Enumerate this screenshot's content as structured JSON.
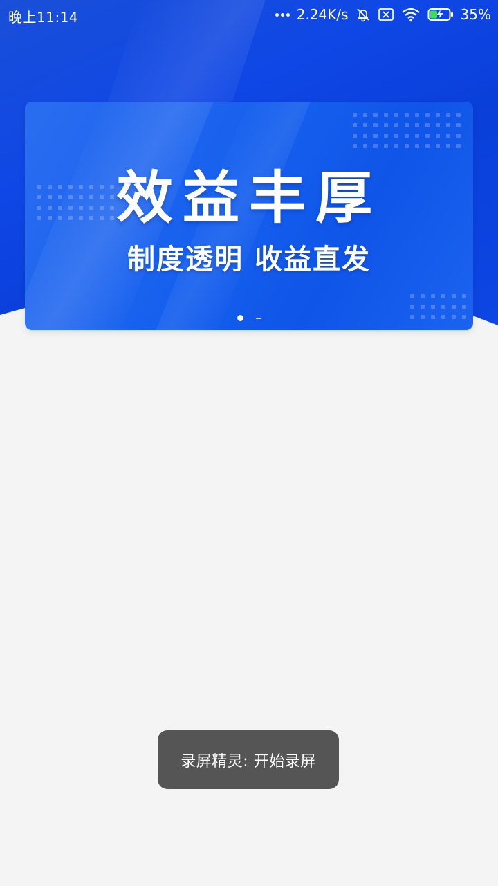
{
  "status_bar": {
    "time": "晚上11:14",
    "network_speed": "2.24K/s",
    "battery_percent": "35%",
    "icons": [
      "more-dots-icon",
      "mute-bell-icon",
      "sim-card-icon",
      "wifi-icon",
      "battery-charging-icon"
    ]
  },
  "banner": {
    "title": "效益丰厚",
    "subtitle": "制度透明 收益直发",
    "page_count": 2,
    "active_page": 1
  },
  "toast": {
    "message": "录屏精灵: 开始录屏"
  },
  "colors": {
    "header_blue": "#0f47e6",
    "banner_blue": "#1660ee",
    "page_background": "#f4f4f4",
    "toast_background": "#505050"
  }
}
